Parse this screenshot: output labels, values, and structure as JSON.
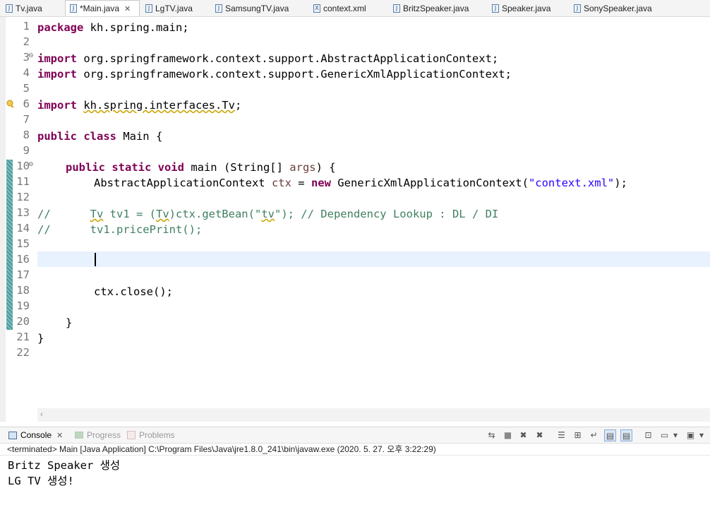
{
  "tabs": [
    {
      "label": "Tv.java",
      "icon": "java-file-icon"
    },
    {
      "label": "*Main.java",
      "icon": "java-file-icon",
      "active": true
    },
    {
      "label": "LgTV.java",
      "icon": "java-file-icon"
    },
    {
      "label": "SamsungTV.java",
      "icon": "java-file-icon"
    },
    {
      "label": "context.xml",
      "icon": "xml-file-icon"
    },
    {
      "label": "BritzSpeaker.java",
      "icon": "java-file-icon"
    },
    {
      "label": "Speaker.java",
      "icon": "java-file-icon"
    },
    {
      "label": "SonySpeaker.java",
      "icon": "java-file-icon"
    }
  ],
  "editor": {
    "line_numbers": [
      "1",
      "2",
      "3",
      "4",
      "5",
      "6",
      "7",
      "8",
      "9",
      "10",
      "11",
      "12",
      "13",
      "14",
      "15",
      "16",
      "17",
      "18",
      "19",
      "20",
      "21",
      "22"
    ],
    "lines": {
      "l1_kw": "package",
      "l1_rest": " kh.spring.main;",
      "l3_kw": "import",
      "l3_rest": " org.springframework.context.support.AbstractApplicationContext;",
      "l4_kw": "import",
      "l4_rest": " org.springframework.context.support.GenericXmlApplicationContext;",
      "l6_kw": "import",
      "l6_rest": "kh.spring.interfaces.Tv",
      "l6_end": ";",
      "l8_kw": "public class",
      "l8_rest": " Main {",
      "l10_kw": "public static void",
      "l10_mid": " main (String[] ",
      "l10_var": "args",
      "l10_end": ") {",
      "l11_a": "AbstractApplicationContext ",
      "l11_var": "ctx",
      "l11_b": " = ",
      "l11_kw": "new",
      "l11_c": " GenericXmlApplicationContext(",
      "l11_str": "\"context.xml\"",
      "l11_end": ");",
      "l13_a": "//      ",
      "l13_tv1": "Tv",
      "l13_b": " tv1 = (",
      "l13_tv2": "Tv",
      "l13_c": ")ctx.getBean(\"",
      "l13_tv3": "tv",
      "l13_d": "\"); // Dependency Lookup : DL / DI",
      "l14": "//      tv1.pricePrint();",
      "l18": "ctx.close();",
      "l20": "}",
      "l21": "}"
    }
  },
  "console": {
    "tabs": [
      {
        "label": "Console",
        "icon": "console-icon",
        "active": true
      },
      {
        "label": "Progress",
        "icon": "progress-icon"
      },
      {
        "label": "Problems",
        "icon": "problems-icon"
      }
    ],
    "status": "<terminated> Main [Java Application] C:\\Program Files\\Java\\jre1.8.0_241\\bin\\javaw.exe (2020. 5. 27. 오후 3:22:29)",
    "output": [
      "Britz Speaker 생성",
      "LG TV 생성!"
    ]
  }
}
